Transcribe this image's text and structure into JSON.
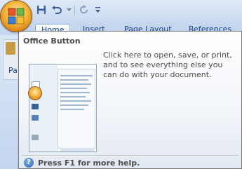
{
  "tabs": [
    {
      "label": "Home"
    },
    {
      "label": "Insert"
    },
    {
      "label": "Page Layout"
    },
    {
      "label": "References"
    }
  ],
  "ribbon": {
    "paste_label": "Pa"
  },
  "tooltip": {
    "title": "Office Button",
    "description": "Click here to open, save, or print, and to see everything else you can do with your document.",
    "help": "Press F1 for more help."
  },
  "colors": {
    "accent": "#15428b",
    "office_orb": "#f5b63c",
    "tooltip_text": "#4c4c4c"
  },
  "icons": {
    "office_button": "office-logo-icon",
    "save": "save-icon",
    "undo": "undo-icon",
    "redo": "redo-icon",
    "customize": "customize-qat-icon",
    "help": "help-icon"
  }
}
